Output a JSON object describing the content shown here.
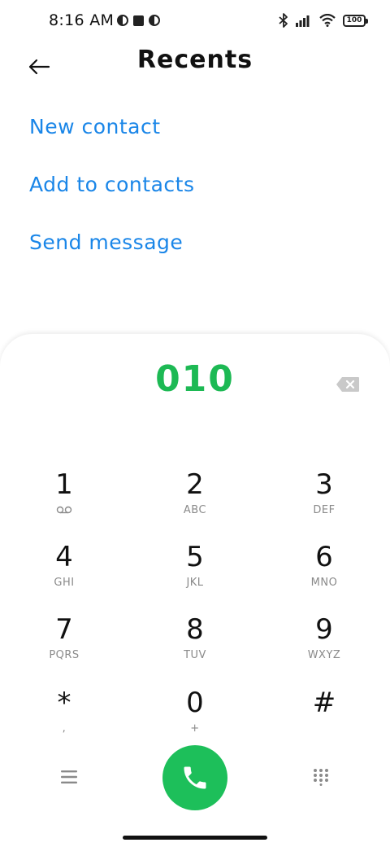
{
  "status_bar": {
    "time": "8:16 AM",
    "left_icons": [
      "half-circle-icon",
      "square-icon",
      "half-circle-icon"
    ],
    "right_icons": [
      "bluetooth-icon",
      "signal-icon",
      "wifi-icon",
      "battery-icon"
    ],
    "battery_level": "100"
  },
  "header": {
    "back_icon": "arrow-left-icon",
    "title": "Recents"
  },
  "actions": [
    {
      "label": "New contact"
    },
    {
      "label": "Add to contacts"
    },
    {
      "label": "Send message"
    }
  ],
  "colors": {
    "accent_blue": "#1a86e8",
    "number_green": "#1db954",
    "call_green": "#1dbf5a"
  },
  "dialpad": {
    "number": "010",
    "backspace_icon": "backspace-icon",
    "keys": [
      {
        "digit": "1",
        "letters": "",
        "icon": "voicemail-icon"
      },
      {
        "digit": "2",
        "letters": "ABC"
      },
      {
        "digit": "3",
        "letters": "DEF"
      },
      {
        "digit": "4",
        "letters": "GHI"
      },
      {
        "digit": "5",
        "letters": "JKL"
      },
      {
        "digit": "6",
        "letters": "MNO"
      },
      {
        "digit": "7",
        "letters": "PQRS"
      },
      {
        "digit": "8",
        "letters": "TUV"
      },
      {
        "digit": "9",
        "letters": "WXYZ"
      },
      {
        "digit": "*",
        "letters": ","
      },
      {
        "digit": "0",
        "letters": "+"
      },
      {
        "digit": "#",
        "letters": ""
      }
    ],
    "bottom": {
      "menu_icon": "menu-icon",
      "call_icon": "phone-icon",
      "keypad_icon": "keypad-icon"
    }
  }
}
